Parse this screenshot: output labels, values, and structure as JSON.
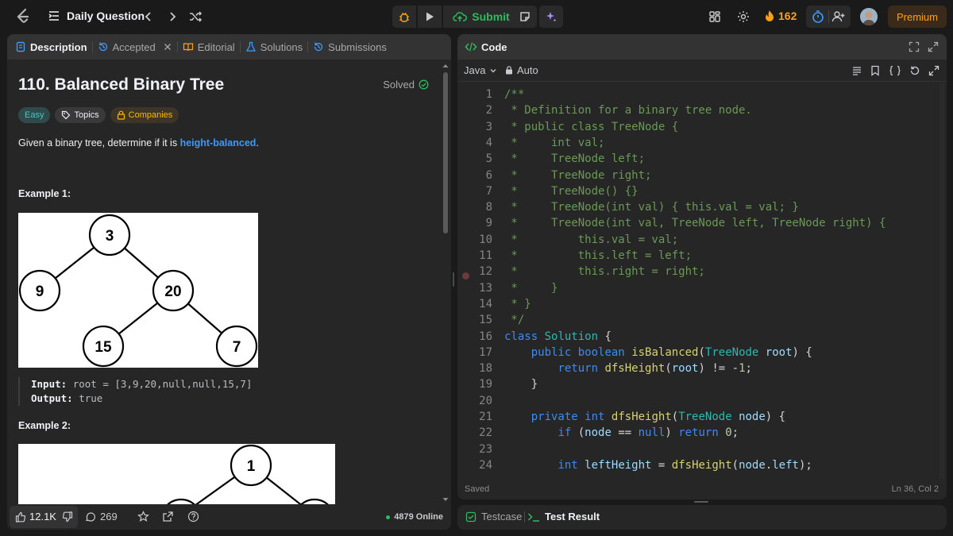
{
  "header": {
    "daily_question": "Daily Question",
    "submit_label": "Submit",
    "streak_count": "162",
    "premium_label": "Premium"
  },
  "desc_tabs": [
    {
      "label": "Description"
    },
    {
      "label": "Accepted"
    },
    {
      "label": "Editorial"
    },
    {
      "label": "Solutions"
    },
    {
      "label": "Submissions"
    }
  ],
  "problem": {
    "title": "110. Balanced Binary Tree",
    "solved_label": "Solved",
    "difficulty": "Easy",
    "topics_label": "Topics",
    "companies_label": "Companies",
    "statement_pre": "Given a binary tree, determine if it is ",
    "statement_link": "height-balanced",
    "statement_post": ".",
    "example1_heading": "Example 1:",
    "example1_input_label": "Input:",
    "example1_input": "root = [3,9,20,null,null,15,7]",
    "example1_output_label": "Output:",
    "example1_output": "true",
    "example2_heading": "Example 2:",
    "tree1_nodes": [
      "3",
      "9",
      "20",
      "15",
      "7"
    ],
    "tree2_nodes": [
      "1"
    ]
  },
  "desc_footer": {
    "likes": "12.1K",
    "comments": "269",
    "online": "4879 Online"
  },
  "code_panel": {
    "tab_label": "Code",
    "language": "Java",
    "auto_label": "Auto",
    "status_saved": "Saved",
    "cursor_pos": "Ln 36, Col 2"
  },
  "code_lines": [
    "/**",
    " * Definition for a binary tree node.",
    " * public class TreeNode {",
    " *     int val;",
    " *     TreeNode left;",
    " *     TreeNode right;",
    " *     TreeNode() {}",
    " *     TreeNode(int val) { this.val = val; }",
    " *     TreeNode(int val, TreeNode left, TreeNode right) {",
    " *         this.val = val;",
    " *         this.left = left;",
    " *         this.right = right;",
    " *     }",
    " * }",
    " */",
    "class Solution {",
    "    public boolean isBalanced(TreeNode root) {",
    "        return dfsHeight(root) != -1;",
    "    }",
    "",
    "    private int dfsHeight(TreeNode node) {",
    "        if (node == null) return 0;",
    "",
    "        int leftHeight = dfsHeight(node.left);"
  ],
  "bottom_tabs": {
    "testcase": "Testcase",
    "test_result": "Test Result"
  }
}
